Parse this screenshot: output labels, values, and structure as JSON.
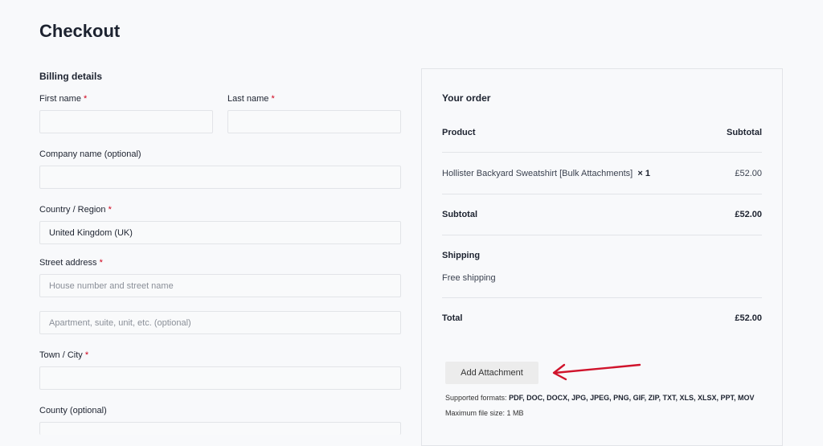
{
  "page": {
    "title": "Checkout"
  },
  "billing": {
    "title": "Billing details",
    "required_mark": "*",
    "first_name": {
      "label": "First name",
      "value": ""
    },
    "last_name": {
      "label": "Last name",
      "value": ""
    },
    "company": {
      "label": "Company name (optional)",
      "value": ""
    },
    "country": {
      "label": "Country / Region",
      "value": "United Kingdom (UK)"
    },
    "street": {
      "label": "Street address",
      "placeholder1": "House number and street name",
      "placeholder2": "Apartment, suite, unit, etc. (optional)"
    },
    "town": {
      "label": "Town / City",
      "value": ""
    },
    "county": {
      "label": "County (optional)",
      "value": ""
    }
  },
  "order": {
    "title": "Your order",
    "col_product": "Product",
    "col_subtotal": "Subtotal",
    "item": {
      "name": "Hollister Backyard Sweatshirt [Bulk Attachments]",
      "qty": "× 1",
      "price": "£52.00"
    },
    "subtotal_label": "Subtotal",
    "subtotal_value": "£52.00",
    "shipping_label": "Shipping",
    "shipping_value": "Free shipping",
    "total_label": "Total",
    "total_value": "£52.00"
  },
  "attachment": {
    "button_label": "Add Attachment",
    "formats_prefix": "Supported formats:",
    "formats_list": "PDF, DOC, DOCX, JPG, JPEG, PNG, GIF, ZIP, TXT, XLS, XLSX, PPT, MOV",
    "max_size": "Maximum file size: 1 MB"
  },
  "colors": {
    "required": "#d0021b",
    "arrow": "#d0142c",
    "text": "#1d2330",
    "border": "#e2e4e8"
  },
  "icons": {
    "annotation_arrow": "arrow-left-icon"
  }
}
